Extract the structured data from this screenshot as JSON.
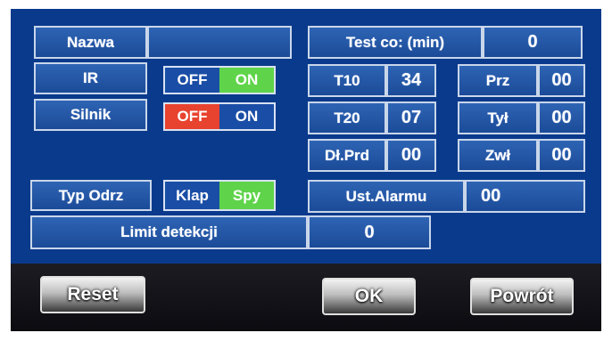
{
  "colors": {
    "screen_bg": "#0a3a8c",
    "field_bg": "#1f55a3",
    "border": "#c9d6ea",
    "on_green": "#5fd44a",
    "off_red": "#e8432f"
  },
  "nazwa": {
    "label": "Nazwa",
    "value": ""
  },
  "ir": {
    "label": "IR",
    "off": "OFF",
    "on": "ON",
    "state": "ON"
  },
  "silnik": {
    "label": "Silnik",
    "off": "OFF",
    "on": "ON",
    "state": "OFF"
  },
  "typ_odrz": {
    "label": "Typ Odrz",
    "opt1": "Klap",
    "opt2": "Spy",
    "selected": "Spy"
  },
  "limit": {
    "label": "Limit detekcji",
    "value": "0"
  },
  "test": {
    "label": "Test co: (min)",
    "value": "0"
  },
  "t10": {
    "label": "T10",
    "value": "34"
  },
  "t20": {
    "label": "T20",
    "value": "07"
  },
  "dlprd": {
    "label": "Dł.Prd",
    "value": "00"
  },
  "prz": {
    "label": "Prz",
    "value": "00"
  },
  "tyl": {
    "label": "Tył",
    "value": "00"
  },
  "zwl": {
    "label": "Zwł",
    "value": "00"
  },
  "alarm": {
    "label": "Ust.Alarmu",
    "value": "00"
  },
  "buttons": {
    "reset": "Reset",
    "ok": "OK",
    "back": "Powrót"
  }
}
